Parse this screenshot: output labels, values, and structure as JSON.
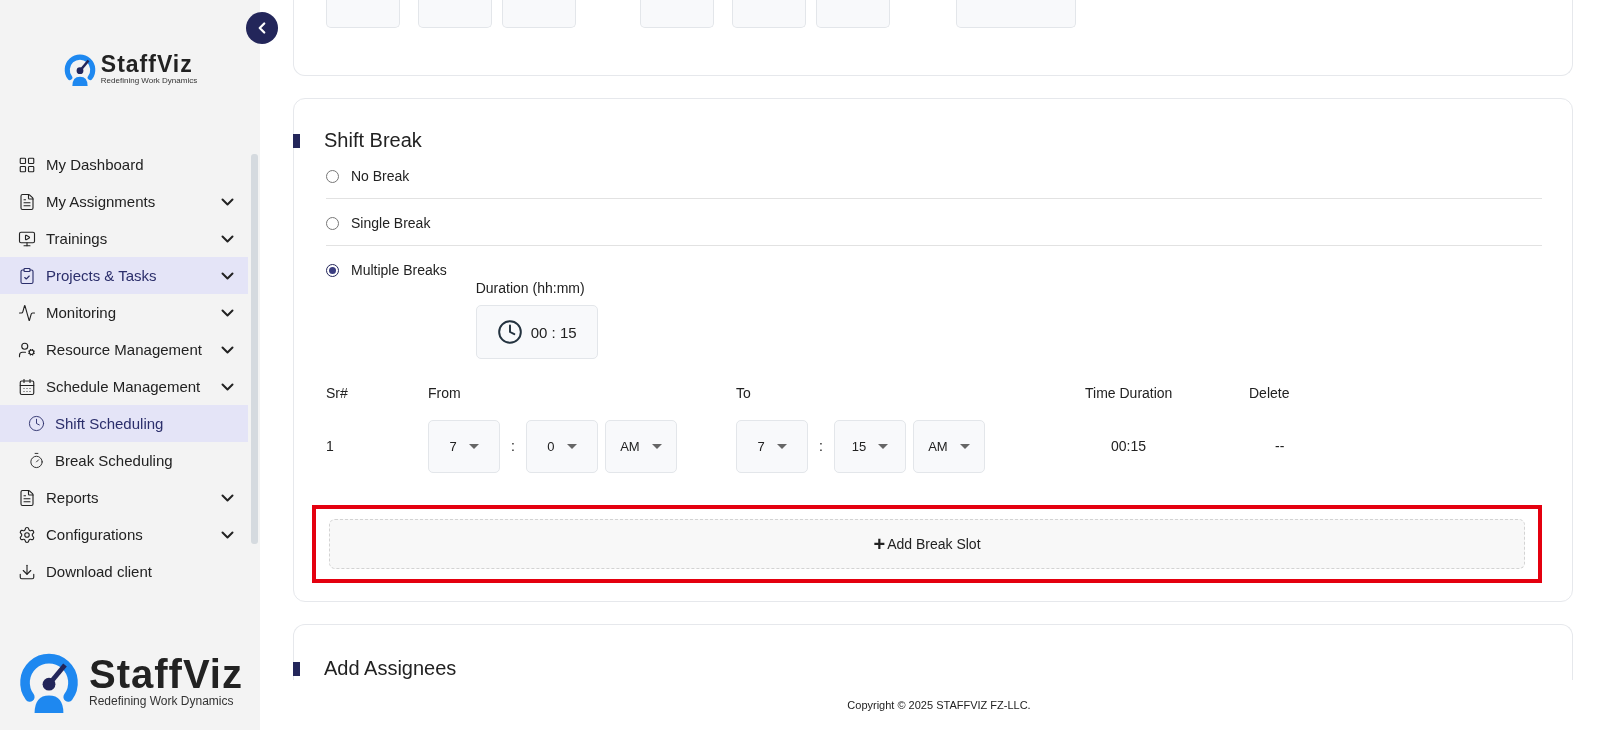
{
  "sidebar": {
    "logo": {
      "name": "StaffViz",
      "tagline": "Redefining Work Dynamics"
    },
    "items": [
      {
        "label": "My Dashboard",
        "selected": false,
        "expandable": false
      },
      {
        "label": "My Assignments",
        "selected": false,
        "expandable": true
      },
      {
        "label": "Trainings",
        "selected": false,
        "expandable": true
      },
      {
        "label": "Projects & Tasks",
        "selected": true,
        "expandable": true
      },
      {
        "label": "Monitoring",
        "selected": false,
        "expandable": true
      },
      {
        "label": "Resource Management",
        "selected": false,
        "expandable": true
      },
      {
        "label": "Schedule Management",
        "selected": false,
        "expandable": true,
        "children": [
          {
            "label": "Shift Scheduling",
            "selected": true
          },
          {
            "label": "Break Scheduling",
            "selected": false
          }
        ]
      },
      {
        "label": "Reports",
        "selected": false,
        "expandable": true
      },
      {
        "label": "Configurations",
        "selected": false,
        "expandable": true
      },
      {
        "label": "Download client",
        "selected": false,
        "expandable": false
      }
    ],
    "bottom_logo": {
      "name": "StaffViz",
      "tagline": "Redefining Work Dynamics"
    }
  },
  "shift_break": {
    "title": "Shift Break",
    "options": [
      {
        "label": "No Break",
        "selected": false
      },
      {
        "label": "Single Break",
        "selected": false
      },
      {
        "label": "Multiple Breaks",
        "selected": true
      }
    ],
    "duration": {
      "label": "Duration (hh:mm)",
      "value": "00 : 15"
    },
    "table": {
      "separator": ":",
      "columns": [
        "Sr#",
        "From",
        "To",
        "Time Duration",
        "Delete"
      ],
      "rows": [
        {
          "sr": "1",
          "from": {
            "hour": "7",
            "minute": "0",
            "period": "AM"
          },
          "to": {
            "hour": "7",
            "minute": "15",
            "period": "AM"
          },
          "duration": "00:15",
          "delete": "--"
        }
      ]
    },
    "add_button": {
      "icon": "+",
      "label": "Add Break Slot",
      "highlighted": true
    }
  },
  "next_section": {
    "title": "Add Assignees"
  },
  "footer": "Copyright © 2025 STAFFVIZ FZ-LLC."
}
